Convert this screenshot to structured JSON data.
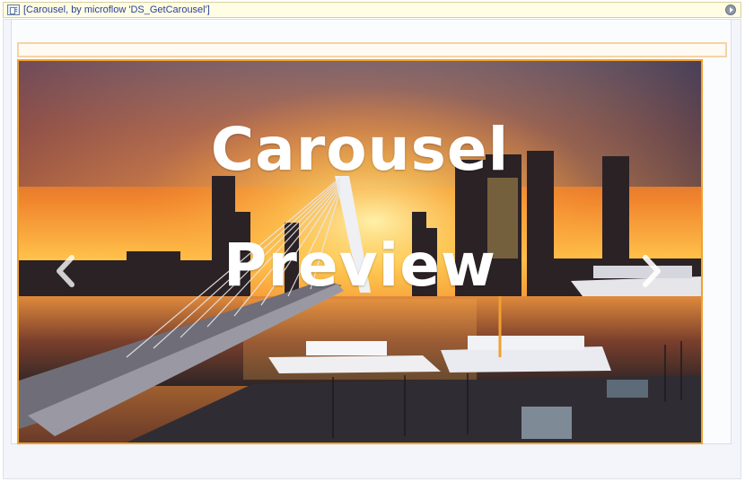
{
  "widget": {
    "caption": "[Carousel, by microflow 'DS_GetCarousel']",
    "icons": [
      "widget-icon",
      "options-icon"
    ]
  },
  "carousel": {
    "overlay_lines": [
      "Carousel",
      "Preview"
    ],
    "prev_icon": "chevron-left-icon",
    "next_icon": "chevron-right-icon",
    "accent_color": "#f1a12c",
    "placeholder_color": "#f6d3a4"
  }
}
